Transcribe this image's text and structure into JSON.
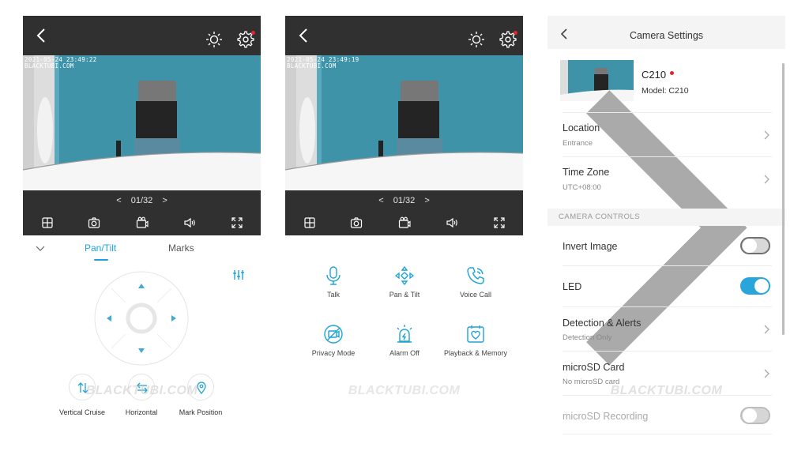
{
  "camera": {
    "timestamp_1": "2021-05-24 23:49:22",
    "timestamp_2": "2021-05-24 23:49:19",
    "watermark_line": "BLACKTUBI.COM",
    "pager": "01/32",
    "prev": "<",
    "next": ">",
    "icons": [
      "back-icon",
      "brightness-icon",
      "settings-icon",
      "grid-icon",
      "snapshot-icon",
      "record-icon",
      "speaker-icon",
      "fullscreen-icon"
    ],
    "notification_color": "#e8212e"
  },
  "pantilt": {
    "tab_pan": "Pan/Tilt",
    "tab_marks": "Marks",
    "buttons": [
      {
        "label": "Vertical Cruise",
        "icon": "vertical-arrows-icon"
      },
      {
        "label": "Horizontal",
        "icon": "horizontal-arrows-icon"
      },
      {
        "label": "Mark Position",
        "icon": "location-pin-icon"
      }
    ],
    "accent": "#1fa3d6"
  },
  "functions": [
    {
      "label": "Talk",
      "icon": "microphone-icon"
    },
    {
      "label": "Pan & Tilt",
      "icon": "pan-tilt-icon"
    },
    {
      "label": "Voice Call",
      "icon": "phone-icon"
    },
    {
      "label": "Privacy Mode",
      "icon": "privacy-icon"
    },
    {
      "label": "Alarm Off",
      "icon": "alarm-icon"
    },
    {
      "label": "Playback & Memory",
      "icon": "sd-card-icon"
    }
  ],
  "watermark": "BLACKTUBI.COM",
  "settings": {
    "title": "Camera Settings",
    "device_name": "C210",
    "device_model": "Model: C210",
    "location_title": "Location",
    "location_value": "Entrance",
    "timezone_title": "Time Zone",
    "timezone_value": "UTC+08:00",
    "section": "CAMERA CONTROLS",
    "invert_title": "Invert Image",
    "invert_on": false,
    "led_title": "LED",
    "led_on": true,
    "detection_title": "Detection & Alerts",
    "detection_value": "Detection Only",
    "sd_title": "microSD Card",
    "sd_value": "No microSD card",
    "sdrec_title": "microSD Recording",
    "sdrec_on": false,
    "toggle_on_color": "#28a6dc"
  }
}
